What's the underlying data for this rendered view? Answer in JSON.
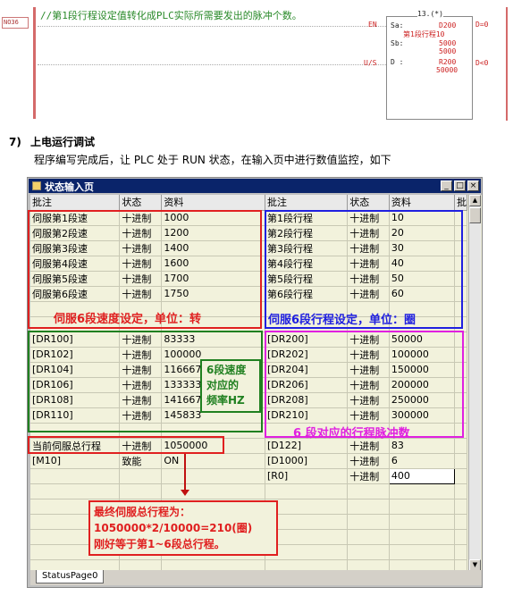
{
  "ladder": {
    "step_no": "NO36",
    "comment": "//第1段行程设定值转化成PLC实际所需要发出的脉冲个数。",
    "instr": "13.(*)",
    "en": "EN",
    "us": "U/S",
    "sa_label": "Sa:",
    "sa_reg": "D200",
    "sa_comment": "第1段行程10",
    "sb_label": "Sb:",
    "sb_reg": "5000",
    "sb_val": "5000",
    "d_label": "D :",
    "d_reg": "R200",
    "d_val": "50000",
    "out1": "D=0",
    "out2": "D<0"
  },
  "heading": {
    "num": "7)",
    "title": "上电运行调试",
    "para": "程序编写完成后，让 PLC 处于 RUN 状态，在输入页中进行数值监控，如下"
  },
  "window": {
    "title": "状态输入页",
    "tab": "StatusPage0",
    "headers": [
      "批注",
      "状态",
      "资料",
      "批注",
      "状态",
      "资料",
      "批"
    ]
  },
  "left_rows": [
    [
      "伺服第1段速",
      "十进制",
      "1000"
    ],
    [
      "伺服第2段速",
      "十进制",
      "1200"
    ],
    [
      "伺服第3段速",
      "十进制",
      "1400"
    ],
    [
      "伺服第4段速",
      "十进制",
      "1600"
    ],
    [
      "伺服第5段速",
      "十进制",
      "1700"
    ],
    [
      "伺服第6段速",
      "十进制",
      "1750"
    ],
    [
      "",
      "",
      ""
    ],
    [
      "",
      "",
      ""
    ],
    [
      "[DR100]",
      "十进制",
      "83333"
    ],
    [
      "[DR102]",
      "十进制",
      "100000"
    ],
    [
      "[DR104]",
      "十进制",
      "116667"
    ],
    [
      "[DR106]",
      "十进制",
      "133333"
    ],
    [
      "[DR108]",
      "十进制",
      "141667"
    ],
    [
      "[DR110]",
      "十进制",
      "145833"
    ],
    [
      "",
      "",
      ""
    ],
    [
      "当前伺服总行程",
      "十进制",
      "1050000"
    ],
    [
      "[M10]",
      "致能",
      "ON"
    ]
  ],
  "right_rows": [
    [
      "第1段行程",
      "十进制",
      "10"
    ],
    [
      "第2段行程",
      "十进制",
      "20"
    ],
    [
      "第3段行程",
      "十进制",
      "30"
    ],
    [
      "第4段行程",
      "十进制",
      "40"
    ],
    [
      "第5段行程",
      "十进制",
      "50"
    ],
    [
      "第6段行程",
      "十进制",
      "60"
    ],
    [
      "",
      "",
      ""
    ],
    [
      "",
      "",
      ""
    ],
    [
      "[DR200]",
      "十进制",
      "50000"
    ],
    [
      "[DR202]",
      "十进制",
      "100000"
    ],
    [
      "[DR204]",
      "十进制",
      "150000"
    ],
    [
      "[DR206]",
      "十进制",
      "200000"
    ],
    [
      "[DR208]",
      "十进制",
      "250000"
    ],
    [
      "[DR210]",
      "十进制",
      "300000"
    ],
    [
      "",
      "",
      ""
    ],
    [
      "[D122]",
      "十进制",
      "83"
    ],
    [
      "[D1000]",
      "十进制",
      "6"
    ],
    [
      "[R0]",
      "十进制",
      "400"
    ]
  ],
  "annotations": {
    "speed": "伺服6段速度设定，单位：转",
    "stroke": "伺服6段行程设定，单位：圈",
    "freq1": "6段速度",
    "freq2": "对应的",
    "freq3": "频率HZ",
    "pulse": "6 段对应的行程脉冲数",
    "total1": "最终伺服总行程为：",
    "total2": "1050000*2/10000=210(圈)",
    "total3": "刚好等于第1~6段总行程。"
  },
  "colors": {
    "red": "#e02020",
    "blue": "#2020e0",
    "green": "#208020",
    "magenta": "#e020e0"
  }
}
